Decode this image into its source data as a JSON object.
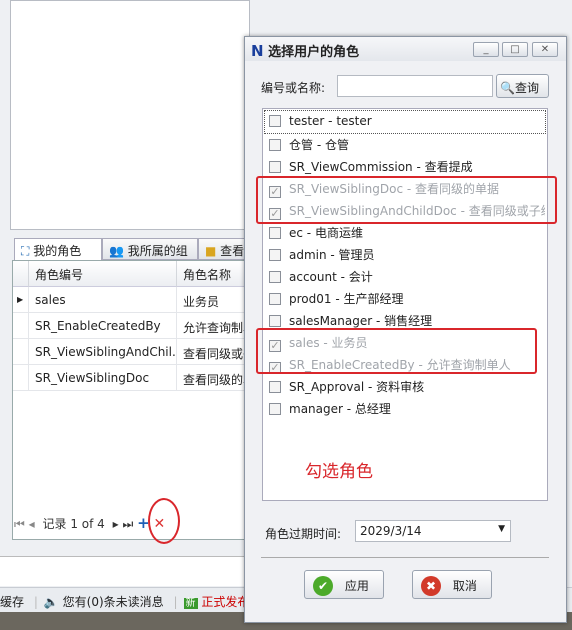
{
  "tabs": [
    {
      "label": "我的角色",
      "icon": "hierarchy-icon"
    },
    {
      "label": "我所属的组",
      "icon": "group-icon"
    },
    {
      "label": "查看",
      "icon": "cube-icon"
    }
  ],
  "grid": {
    "columns": [
      "角色编号",
      "角色名称"
    ],
    "rows": [
      [
        "sales",
        "业务员"
      ],
      [
        "SR_EnableCreatedBy",
        "允许查询制单"
      ],
      [
        "SR_ViewSiblingAndChil...",
        "查看同级或子"
      ],
      [
        "SR_ViewSiblingDoc",
        "查看同级的单"
      ]
    ]
  },
  "navigator": {
    "record_text": "记录 1 of 4",
    "add": "+",
    "delete": "✕"
  },
  "status": {
    "cache": "缓存",
    "messages": "您有(0)条未读消息",
    "release": "正式发布"
  },
  "dialog": {
    "title": "选择用户的角色",
    "logo": "N",
    "search_label": "编号或名称:",
    "search_value": "",
    "search_button": "查询",
    "items": [
      {
        "label": "tester - tester",
        "checked": false,
        "disabled": false
      },
      {
        "label": "仓管 - 仓管",
        "checked": false,
        "disabled": false
      },
      {
        "label": "SR_ViewCommission - 查看提成",
        "checked": false,
        "disabled": false
      },
      {
        "label": "SR_ViewSiblingDoc - 查看同级的单据",
        "checked": true,
        "disabled": true
      },
      {
        "label": "SR_ViewSiblingAndChildDoc - 查看同级或子级单据",
        "checked": true,
        "disabled": true
      },
      {
        "label": "ec - 电商运维",
        "checked": false,
        "disabled": false
      },
      {
        "label": "admin - 管理员",
        "checked": false,
        "disabled": false
      },
      {
        "label": "account - 会计",
        "checked": false,
        "disabled": false
      },
      {
        "label": "prod01 - 生产部经理",
        "checked": false,
        "disabled": false
      },
      {
        "label": "salesManager - 销售经理",
        "checked": false,
        "disabled": false
      },
      {
        "label": "sales - 业务员",
        "checked": true,
        "disabled": true
      },
      {
        "label": "SR_EnableCreatedBy - 允许查询制单人",
        "checked": true,
        "disabled": true
      },
      {
        "label": "SR_Approval - 资料审核",
        "checked": false,
        "disabled": false
      },
      {
        "label": "manager - 总经理",
        "checked": false,
        "disabled": false
      }
    ],
    "annotation": "勾选角色",
    "expire_label": "角色过期时间:",
    "expire_value": "2029/3/14",
    "apply": "应用",
    "cancel": "取消"
  },
  "colors": {
    "annotation": "#d9262b",
    "accent": "#1a3f9c"
  }
}
